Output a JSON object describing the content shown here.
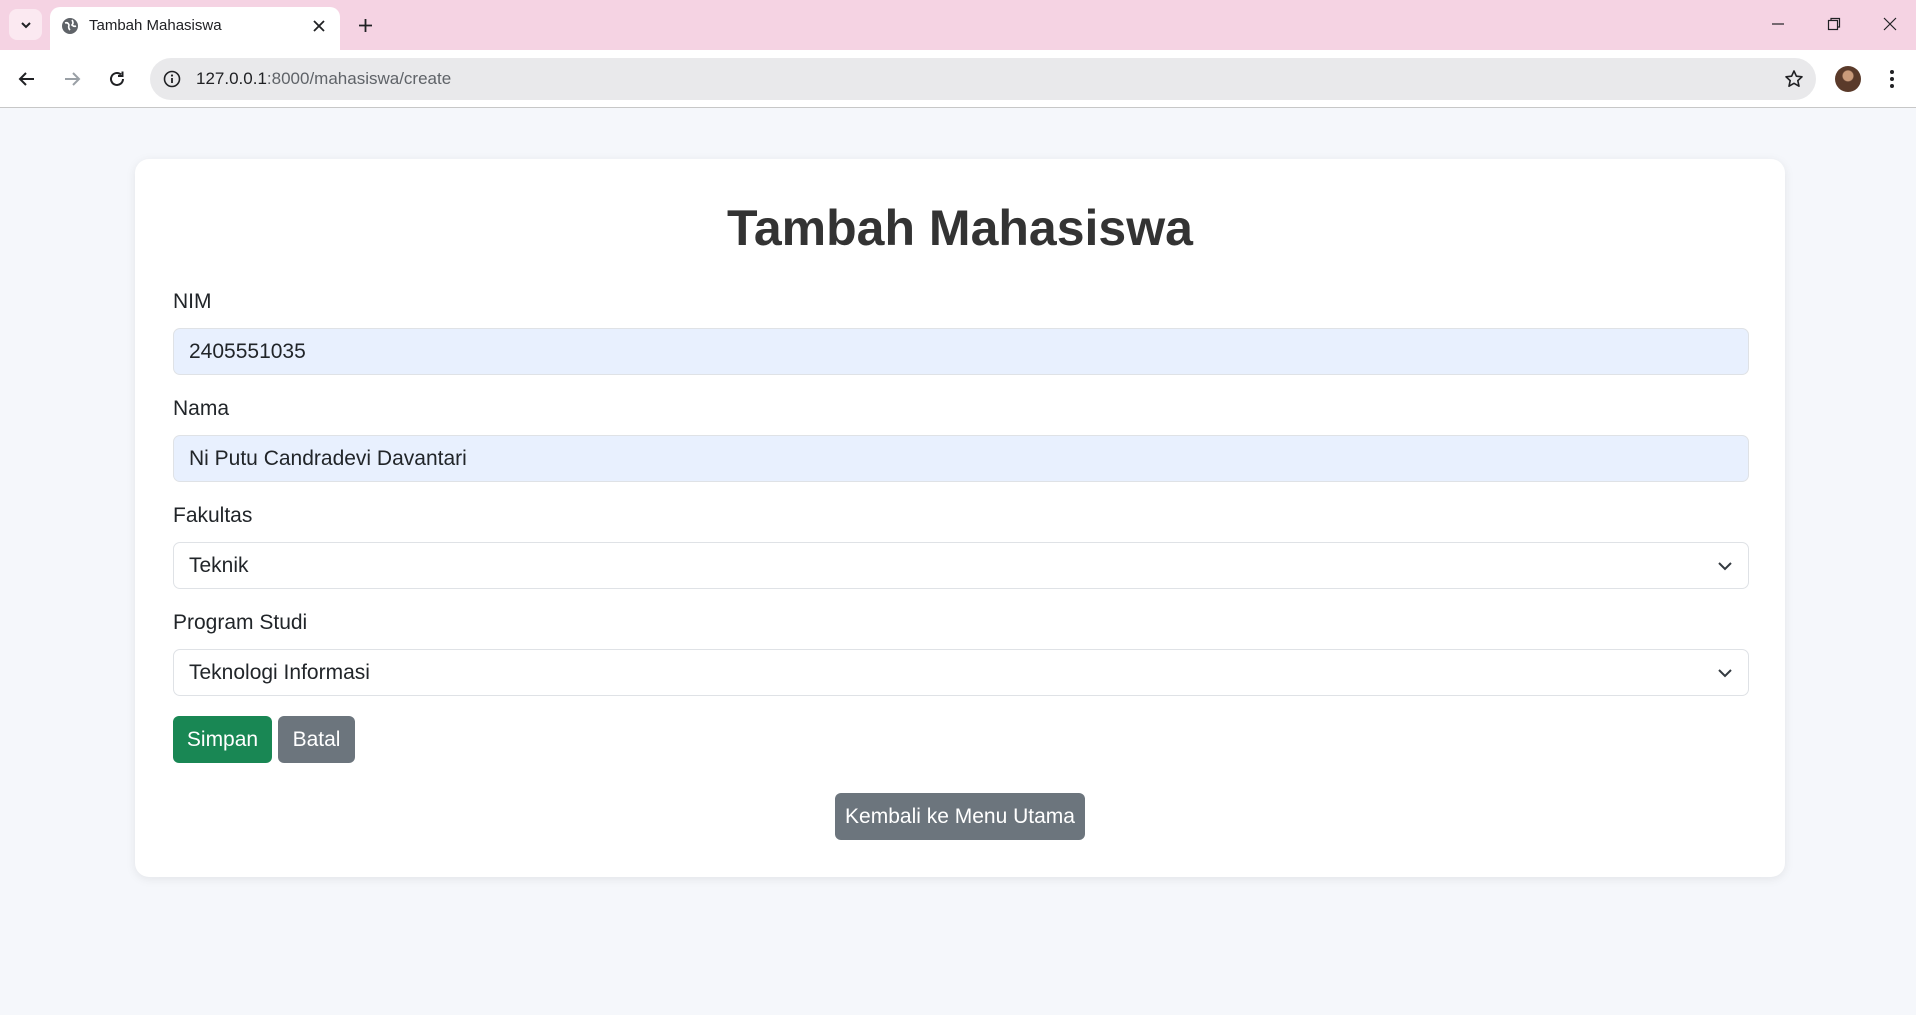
{
  "browser": {
    "tab_title": "Tambah Mahasiswa",
    "url_host": "127.0.0.1",
    "url_path": ":8000/mahasiswa/create"
  },
  "form": {
    "title": "Tambah Mahasiswa",
    "nim": {
      "label": "NIM",
      "value": "2405551035"
    },
    "nama": {
      "label": "Nama",
      "value": "Ni Putu Candradevi Davantari"
    },
    "fakultas": {
      "label": "Fakultas",
      "selected": "Teknik"
    },
    "prodi": {
      "label": "Program Studi",
      "selected": "Teknologi Informasi"
    },
    "save_label": "Simpan",
    "cancel_label": "Batal",
    "back_label": "Kembali ke Menu Utama"
  },
  "colors": {
    "tabbar": "#f5d3e3",
    "page_bg": "#f5f7fb",
    "autofill": "#e8f0fe",
    "success": "#198754",
    "secondary": "#6c757d"
  },
  "icons": [
    "tab-search-icon",
    "globe-icon",
    "close-icon",
    "plus-icon",
    "minimize-icon",
    "restore-icon",
    "window-close-icon",
    "back-arrow-icon",
    "forward-arrow-icon",
    "reload-icon",
    "info-icon",
    "star-icon",
    "avatar",
    "kebab-menu-icon",
    "chevron-down-icon"
  ]
}
